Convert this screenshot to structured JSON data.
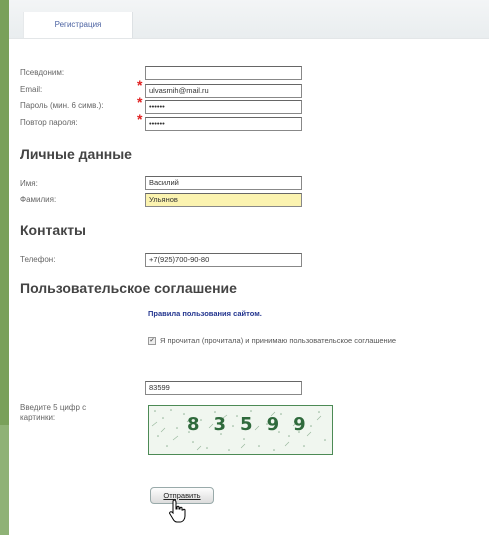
{
  "tab": {
    "label": "Регистрация"
  },
  "account": {
    "nickname_label": "Псевдоним:",
    "nickname_value": "",
    "email_label": "Email:",
    "email_value": "ulvasmih@mail.ru",
    "password_label": "Пароль (мин. 6 симв.):",
    "password_value": "••••••",
    "password_repeat_label": "Повтор пароля:",
    "password_repeat_value": "••••••"
  },
  "personal": {
    "heading": "Личные данные",
    "first_name_label": "Имя:",
    "first_name_value": "Василий",
    "last_name_label": "Фамилия:",
    "last_name_value": "Ульянов"
  },
  "contacts": {
    "heading": "Контакты",
    "phone_label": "Телефон:",
    "phone_value": "+7(925)700-90-80"
  },
  "agreement": {
    "heading": "Пользовательское соглашение",
    "rules_link": "Правила пользования сайтом.",
    "checkbox_label": "Я прочитал (прочитала) и принимаю пользовательское соглашение",
    "checked": true
  },
  "captcha": {
    "label_line1": "Введите 5 цифр с",
    "label_line2": "картинки:",
    "input_value": "83599",
    "image_text": "83599"
  },
  "submit": {
    "label": "Отправить"
  },
  "colors": {
    "page_border": "#79a05a",
    "link": "#23358f",
    "required_star": "#e02020",
    "highlight_field": "#fbf3b0",
    "captcha_border": "#4c8a55"
  }
}
